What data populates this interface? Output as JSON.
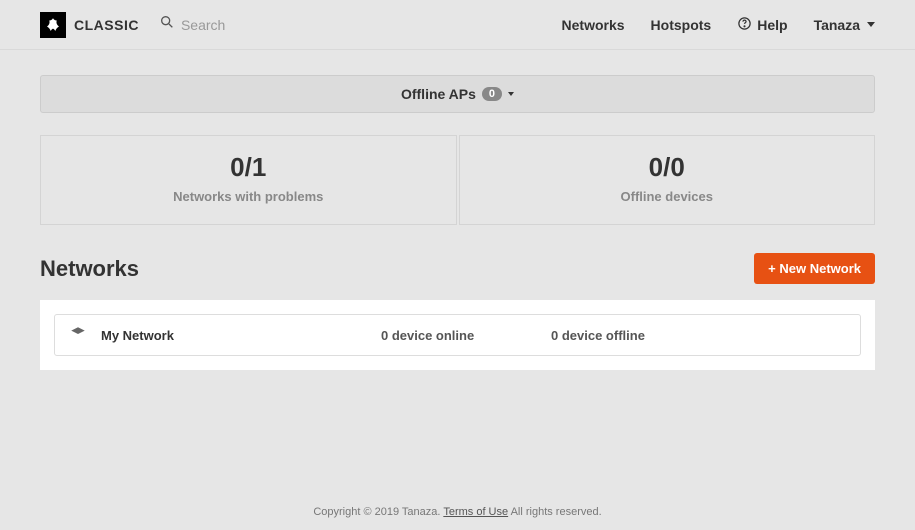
{
  "brand": {
    "name": "CLASSIC"
  },
  "search": {
    "placeholder": "Search"
  },
  "nav": {
    "networks": "Networks",
    "hotspots": "Hotspots",
    "help": "Help",
    "user": "Tanaza"
  },
  "offline_bar": {
    "label": "Offline APs",
    "count": "0"
  },
  "stats": {
    "net_problems": {
      "value": "0/1",
      "label": "Networks with problems"
    },
    "offline_devices": {
      "value": "0/0",
      "label": "Offline devices"
    }
  },
  "section": {
    "title": "Networks",
    "new_button": "+ New Network"
  },
  "networks": [
    {
      "name": "My Network",
      "online": "0 device online",
      "offline": "0 device offline"
    }
  ],
  "footer": {
    "pre": "Copyright © 2019 Tanaza. ",
    "link": "Terms of Use",
    "post": " All rights reserved."
  }
}
